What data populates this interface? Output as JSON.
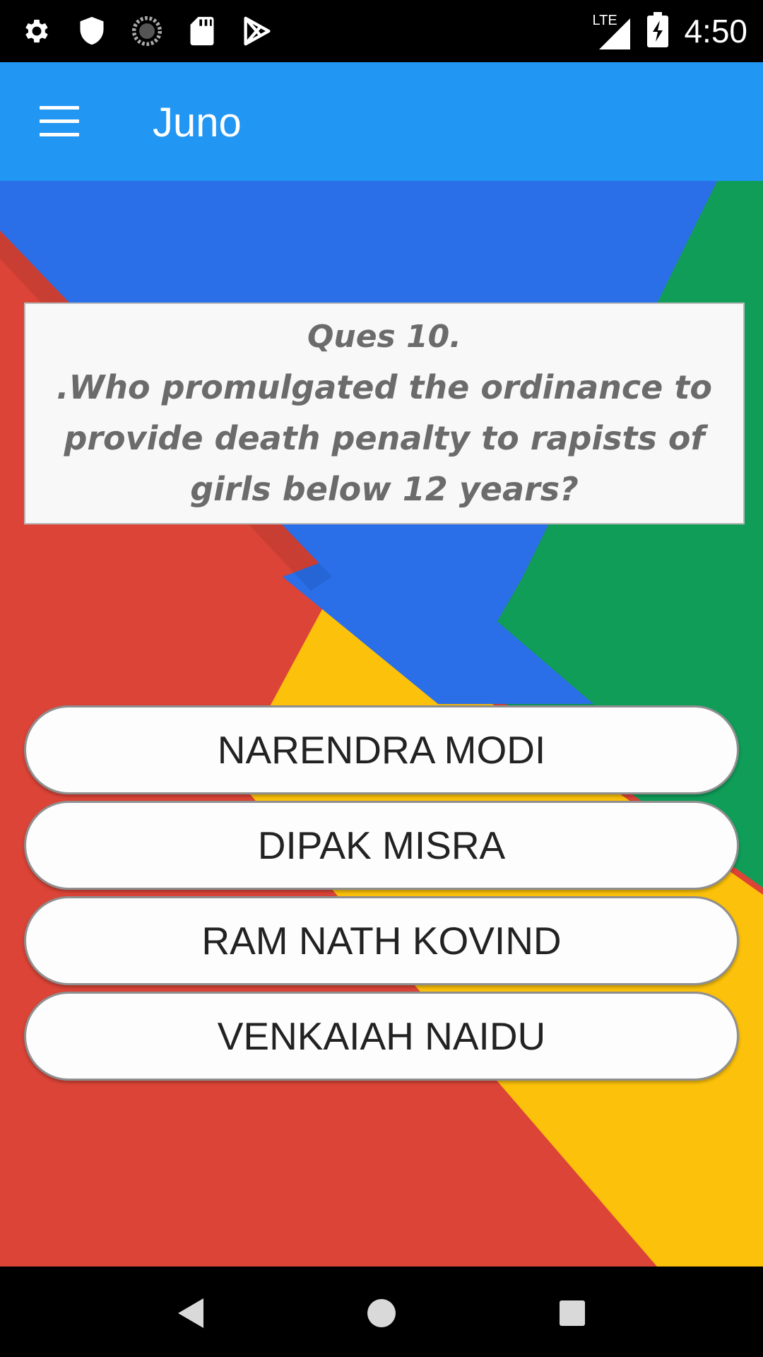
{
  "status_bar": {
    "time": "4:50",
    "network": "LTE",
    "icons": [
      "settings-icon",
      "shield-icon",
      "sync-icon",
      "sd-card-icon",
      "play-store-icon",
      "signal-icon",
      "battery-charging-icon"
    ]
  },
  "app_bar": {
    "title": "Juno",
    "menu_icon": "hamburger-menu-icon"
  },
  "quiz": {
    "question_number": "Ques 10.",
    "question_text": ".Who promulgated the ordinance to provide death penalty to rapists of girls below 12 years?",
    "options": [
      "NARENDRA MODI",
      "DIPAK MISRA",
      "RAM NATH KOVIND",
      "VENKAIAH NAIDU"
    ]
  },
  "nav_bar": {
    "icons": [
      "back-icon",
      "home-icon",
      "recents-icon"
    ]
  },
  "colors": {
    "app_bar": "#2196F3",
    "red": "#DB4437",
    "blue": "#2A6EE8",
    "green": "#0F9D58",
    "yellow": "#FCC10A"
  }
}
